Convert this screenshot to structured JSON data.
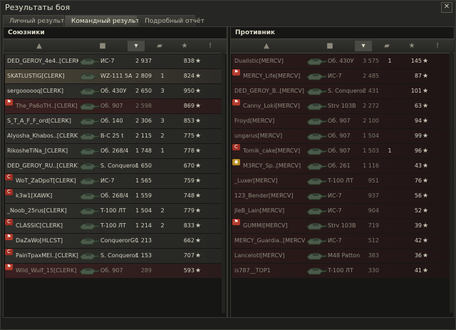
{
  "window": {
    "title": "Результаты боя",
    "close_label": "✕"
  },
  "tabs": [
    {
      "label": "Личный результат",
      "active": false
    },
    {
      "label": "Командный результат",
      "active": true
    },
    {
      "label": "Подробный отчёт",
      "active": false
    }
  ],
  "allies": {
    "title": "Союзники",
    "rows": [
      {
        "name": "DED_GEROY_4e4..[CLERK]",
        "tank": "ИС-7",
        "damage": "2 937",
        "kills": "",
        "xp": "838",
        "badge": "",
        "state": "alive"
      },
      {
        "name": "SKATLUSTIG[CLERK]",
        "tank": "WZ-111 5A",
        "damage": "2 809",
        "kills": "1",
        "xp": "824",
        "badge": "",
        "state": "self"
      },
      {
        "name": "sergoooooq[CLERK]",
        "tank": "Об. 430У",
        "damage": "2 650",
        "kills": "3",
        "xp": "950",
        "badge": "",
        "state": "alive"
      },
      {
        "name": "The_Ра6оТН..[CLERK]",
        "tank": "Об. 907",
        "damage": "2 598",
        "kills": "",
        "xp": "869",
        "badge": "flag",
        "state": "destroyed"
      },
      {
        "name": "S_T_A_F_F_ord[CLERK]",
        "tank": "Об. 140",
        "damage": "2 306",
        "kills": "3",
        "xp": "853",
        "badge": "",
        "state": "alive"
      },
      {
        "name": "Alyosha_Khabos..[CLERK]",
        "tank": "B-C 25 t",
        "damage": "2 115",
        "kills": "2",
        "xp": "775",
        "badge": "",
        "state": "alive"
      },
      {
        "name": "RikosheTiNa_[CLERK]",
        "tank": "Об. 268/4",
        "damage": "1 748",
        "kills": "1",
        "xp": "778",
        "badge": "",
        "state": "alive"
      },
      {
        "name": "DED_GEROY_RU..[CLERK]",
        "tank": "S. Conqueror",
        "damage": "1 650",
        "kills": "",
        "xp": "670",
        "badge": "",
        "state": "alive"
      },
      {
        "name": "WoT_ZaDpoT[CLERK]",
        "tank": "ИС-7",
        "damage": "1 565",
        "kills": "",
        "xp": "759",
        "badge": "c",
        "state": "alive"
      },
      {
        "name": "k3w1[XAWK]",
        "tank": "Об. 268/4",
        "damage": "1 559",
        "kills": "",
        "xp": "748",
        "badge": "c",
        "state": "alive"
      },
      {
        "name": "_Noob_25rus[CLERK]",
        "tank": "T-100 ЛТ",
        "damage": "1 504",
        "kills": "2",
        "xp": "779",
        "badge": "",
        "state": "alive"
      },
      {
        "name": "CLASSIC[CLERK]",
        "tank": "T-100 ЛТ",
        "damage": "1 214",
        "kills": "2",
        "xp": "833",
        "badge": "c",
        "state": "alive"
      },
      {
        "name": "DaZaWo[HLCST]",
        "tank": "ConquerorGC",
        "damage": "1 213",
        "kills": "",
        "xp": "662",
        "badge": "flag",
        "state": "alive"
      },
      {
        "name": "PainTpaxMEI..[CLERK]",
        "tank": "S. Conqueror",
        "damage": "1 153",
        "kills": "",
        "xp": "707",
        "badge": "c",
        "state": "alive"
      },
      {
        "name": "Wild_Wulf_15[CLERK]",
        "tank": "Об. 907",
        "damage": "289",
        "kills": "",
        "xp": "593",
        "badge": "flag",
        "state": "destroyed"
      }
    ]
  },
  "enemies": {
    "title": "Противник",
    "rows": [
      {
        "name": "Dualistic[MERCV]",
        "tank": "Об. 430У",
        "damage": "3 575",
        "kills": "1",
        "xp": "145",
        "badge": "",
        "state": "destroyed"
      },
      {
        "name": "MERCY_Life[MERCV]",
        "tank": "ИС-7",
        "damage": "2 485",
        "kills": "",
        "xp": "87",
        "badge": "flag",
        "state": "destroyed"
      },
      {
        "name": "DED_GEROY_B..[MERCV]",
        "tank": "S. Conqueror",
        "damage": "2 431",
        "kills": "",
        "xp": "101",
        "badge": "",
        "state": "destroyed"
      },
      {
        "name": "Canny_Loki[MERCV]",
        "tank": "Strv 103B",
        "damage": "2 272",
        "kills": "",
        "xp": "63",
        "badge": "flag",
        "state": "destroyed"
      },
      {
        "name": "Froyd[MERCV]",
        "tank": "Об. 907",
        "damage": "2 100",
        "kills": "",
        "xp": "94",
        "badge": "",
        "state": "destroyed"
      },
      {
        "name": "ungarus[MERCV]",
        "tank": "Об. 907",
        "damage": "1 504",
        "kills": "",
        "xp": "99",
        "badge": "",
        "state": "destroyed"
      },
      {
        "name": "Tomik_cake[MERCV]",
        "tank": "Об. 907",
        "damage": "1 503",
        "kills": "1",
        "xp": "96",
        "badge": "c",
        "state": "destroyed"
      },
      {
        "name": "M3RCY_Sp..[MERCV]",
        "tank": "Об. 261",
        "damage": "1 116",
        "kills": "",
        "xp": "43",
        "badge": "gold",
        "state": "destroyed"
      },
      {
        "name": "_Luxer[MERCV]",
        "tank": "T-100 ЛТ",
        "damage": "951",
        "kills": "",
        "xp": "76",
        "badge": "",
        "state": "destroyed"
      },
      {
        "name": "123_Bender[MERCV]",
        "tank": "ИС-7",
        "damage": "937",
        "kills": "",
        "xp": "56",
        "badge": "",
        "state": "destroyed"
      },
      {
        "name": "JleB_Lain[MERCV]",
        "tank": "ИС-7",
        "damage": "904",
        "kills": "",
        "xp": "52",
        "badge": "",
        "state": "destroyed"
      },
      {
        "name": "GUMMI[MERCV]",
        "tank": "Strv 103B",
        "damage": "719",
        "kills": "",
        "xp": "39",
        "badge": "flag",
        "state": "destroyed"
      },
      {
        "name": "MERCY_Guardia..[MERCV]",
        "tank": "ИС-7",
        "damage": "512",
        "kills": "",
        "xp": "42",
        "badge": "",
        "state": "destroyed"
      },
      {
        "name": "Lancelotl[MERCV]",
        "tank": "M48 Patton",
        "damage": "383",
        "kills": "",
        "xp": "36",
        "badge": "",
        "state": "destroyed"
      },
      {
        "name": "is787__TOP1",
        "tank": "T-100 ЛТ",
        "damage": "330",
        "kills": "",
        "xp": "41",
        "badge": "",
        "state": "destroyed"
      }
    ]
  },
  "icons": {
    "player": "player-icon",
    "tank": "tank-icon",
    "damage": "damage-icon",
    "kills": "kills-icon",
    "xp": "xp-star-icon",
    "status": "status-icon"
  }
}
